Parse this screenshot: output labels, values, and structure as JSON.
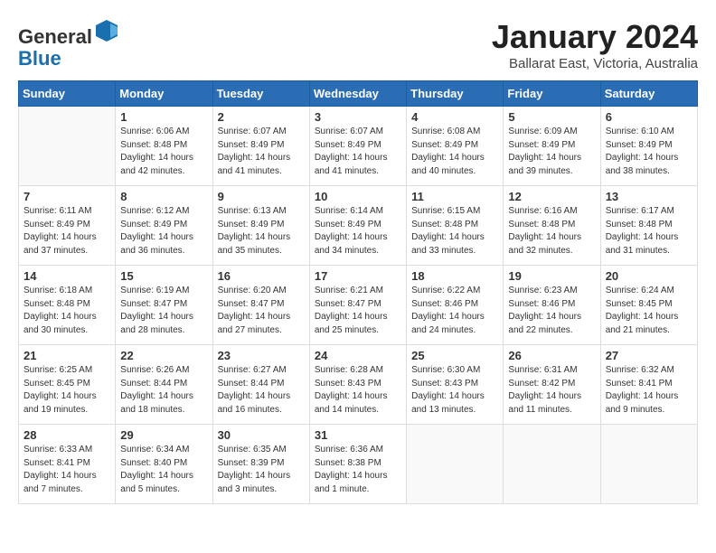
{
  "header": {
    "logo_line1": "General",
    "logo_line2": "Blue",
    "month_year": "January 2024",
    "location": "Ballarat East, Victoria, Australia"
  },
  "days_of_week": [
    "Sunday",
    "Monday",
    "Tuesday",
    "Wednesday",
    "Thursday",
    "Friday",
    "Saturday"
  ],
  "weeks": [
    [
      {
        "day": "",
        "sunrise": "",
        "sunset": "",
        "daylight": ""
      },
      {
        "day": "1",
        "sunrise": "6:06 AM",
        "sunset": "8:48 PM",
        "daylight": "14 hours and 42 minutes."
      },
      {
        "day": "2",
        "sunrise": "6:07 AM",
        "sunset": "8:49 PM",
        "daylight": "14 hours and 41 minutes."
      },
      {
        "day": "3",
        "sunrise": "6:07 AM",
        "sunset": "8:49 PM",
        "daylight": "14 hours and 41 minutes."
      },
      {
        "day": "4",
        "sunrise": "6:08 AM",
        "sunset": "8:49 PM",
        "daylight": "14 hours and 40 minutes."
      },
      {
        "day": "5",
        "sunrise": "6:09 AM",
        "sunset": "8:49 PM",
        "daylight": "14 hours and 39 minutes."
      },
      {
        "day": "6",
        "sunrise": "6:10 AM",
        "sunset": "8:49 PM",
        "daylight": "14 hours and 38 minutes."
      }
    ],
    [
      {
        "day": "7",
        "sunrise": "6:11 AM",
        "sunset": "8:49 PM",
        "daylight": "14 hours and 37 minutes."
      },
      {
        "day": "8",
        "sunrise": "6:12 AM",
        "sunset": "8:49 PM",
        "daylight": "14 hours and 36 minutes."
      },
      {
        "day": "9",
        "sunrise": "6:13 AM",
        "sunset": "8:49 PM",
        "daylight": "14 hours and 35 minutes."
      },
      {
        "day": "10",
        "sunrise": "6:14 AM",
        "sunset": "8:49 PM",
        "daylight": "14 hours and 34 minutes."
      },
      {
        "day": "11",
        "sunrise": "6:15 AM",
        "sunset": "8:48 PM",
        "daylight": "14 hours and 33 minutes."
      },
      {
        "day": "12",
        "sunrise": "6:16 AM",
        "sunset": "8:48 PM",
        "daylight": "14 hours and 32 minutes."
      },
      {
        "day": "13",
        "sunrise": "6:17 AM",
        "sunset": "8:48 PM",
        "daylight": "14 hours and 31 minutes."
      }
    ],
    [
      {
        "day": "14",
        "sunrise": "6:18 AM",
        "sunset": "8:48 PM",
        "daylight": "14 hours and 30 minutes."
      },
      {
        "day": "15",
        "sunrise": "6:19 AM",
        "sunset": "8:47 PM",
        "daylight": "14 hours and 28 minutes."
      },
      {
        "day": "16",
        "sunrise": "6:20 AM",
        "sunset": "8:47 PM",
        "daylight": "14 hours and 27 minutes."
      },
      {
        "day": "17",
        "sunrise": "6:21 AM",
        "sunset": "8:47 PM",
        "daylight": "14 hours and 25 minutes."
      },
      {
        "day": "18",
        "sunrise": "6:22 AM",
        "sunset": "8:46 PM",
        "daylight": "14 hours and 24 minutes."
      },
      {
        "day": "19",
        "sunrise": "6:23 AM",
        "sunset": "8:46 PM",
        "daylight": "14 hours and 22 minutes."
      },
      {
        "day": "20",
        "sunrise": "6:24 AM",
        "sunset": "8:45 PM",
        "daylight": "14 hours and 21 minutes."
      }
    ],
    [
      {
        "day": "21",
        "sunrise": "6:25 AM",
        "sunset": "8:45 PM",
        "daylight": "14 hours and 19 minutes."
      },
      {
        "day": "22",
        "sunrise": "6:26 AM",
        "sunset": "8:44 PM",
        "daylight": "14 hours and 18 minutes."
      },
      {
        "day": "23",
        "sunrise": "6:27 AM",
        "sunset": "8:44 PM",
        "daylight": "14 hours and 16 minutes."
      },
      {
        "day": "24",
        "sunrise": "6:28 AM",
        "sunset": "8:43 PM",
        "daylight": "14 hours and 14 minutes."
      },
      {
        "day": "25",
        "sunrise": "6:30 AM",
        "sunset": "8:43 PM",
        "daylight": "14 hours and 13 minutes."
      },
      {
        "day": "26",
        "sunrise": "6:31 AM",
        "sunset": "8:42 PM",
        "daylight": "14 hours and 11 minutes."
      },
      {
        "day": "27",
        "sunrise": "6:32 AM",
        "sunset": "8:41 PM",
        "daylight": "14 hours and 9 minutes."
      }
    ],
    [
      {
        "day": "28",
        "sunrise": "6:33 AM",
        "sunset": "8:41 PM",
        "daylight": "14 hours and 7 minutes."
      },
      {
        "day": "29",
        "sunrise": "6:34 AM",
        "sunset": "8:40 PM",
        "daylight": "14 hours and 5 minutes."
      },
      {
        "day": "30",
        "sunrise": "6:35 AM",
        "sunset": "8:39 PM",
        "daylight": "14 hours and 3 minutes."
      },
      {
        "day": "31",
        "sunrise": "6:36 AM",
        "sunset": "8:38 PM",
        "daylight": "14 hours and 1 minute."
      },
      {
        "day": "",
        "sunrise": "",
        "sunset": "",
        "daylight": ""
      },
      {
        "day": "",
        "sunrise": "",
        "sunset": "",
        "daylight": ""
      },
      {
        "day": "",
        "sunrise": "",
        "sunset": "",
        "daylight": ""
      }
    ]
  ]
}
